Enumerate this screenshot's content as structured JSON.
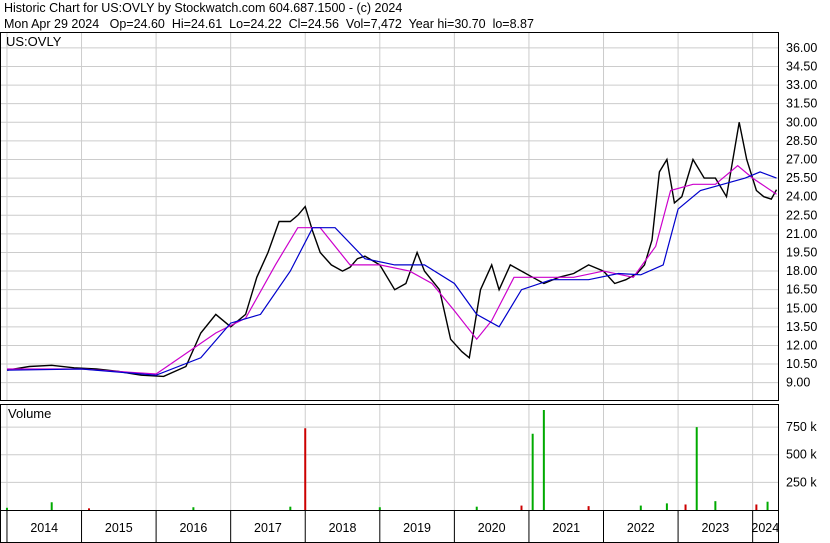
{
  "header": {
    "line1": "Historic Chart for US:OVLY by Stockwatch.com 604.687.1500 - (c) 2024",
    "line2": "Mon Apr 29 2024   Op=24.60  Hi=24.61  Lo=24.22  Cl=24.56  Vol=7,472  Year hi=30.70  lo=8.87"
  },
  "price_panel": {
    "symbol_label": "US:OVLY"
  },
  "volume_panel": {
    "label": "Volume"
  },
  "colors": {
    "price": "#000000",
    "ma_short": "#ff0000",
    "ma_mid": "#cc00cc",
    "ma_long": "#0000cc",
    "vol_up": "#00aa00",
    "vol_down": "#cc0000",
    "grid": "#cccccc"
  },
  "chart_data": {
    "type": "line",
    "price_axis": {
      "ticks": [
        "36.00",
        "34.50",
        "33.00",
        "31.50",
        "30.00",
        "28.50",
        "27.00",
        "25.50",
        "24.00",
        "22.50",
        "21.00",
        "19.50",
        "18.00",
        "16.50",
        "15.00",
        "13.50",
        "12.00",
        "10.50",
        "9.00"
      ],
      "ylim": [
        7.6,
        37.2
      ]
    },
    "volume_axis": {
      "ticks": [
        "750 k",
        "500 k",
        "250 k"
      ],
      "ylim": [
        0,
        950
      ]
    },
    "x_axis": {
      "ticks": [
        "2014",
        "2015",
        "2016",
        "2017",
        "2018",
        "2019",
        "2020",
        "2021",
        "2022",
        "2023",
        "2024"
      ],
      "xlim": [
        2013.92,
        2024.34
      ]
    },
    "series": [
      {
        "x": [
          2014.0,
          2014.3,
          2014.6,
          2014.9,
          2015.2,
          2015.5,
          2015.8,
          2016.1,
          2016.4,
          2016.6,
          2016.8,
          2017.0,
          2017.2,
          2017.35,
          2017.5,
          2017.65,
          2017.8,
          2017.9,
          2018.0,
          2018.1,
          2018.2,
          2018.35,
          2018.5,
          2018.6,
          2018.7,
          2018.8,
          2019.0,
          2019.2,
          2019.35,
          2019.5,
          2019.6,
          2019.8,
          2019.95,
          2020.1,
          2020.2,
          2020.35,
          2020.5,
          2020.6,
          2020.75,
          2020.9,
          2021.05,
          2021.2,
          2021.4,
          2021.6,
          2021.8,
          2022.0,
          2022.15,
          2022.3,
          2022.45,
          2022.55,
          2022.65,
          2022.75,
          2022.85,
          2022.95,
          2023.05,
          2023.2,
          2023.35,
          2023.5,
          2023.65,
          2023.72,
          2023.82,
          2023.92,
          2024.05,
          2024.15,
          2024.25,
          2024.32
        ],
        "values": [
          10.0,
          10.3,
          10.4,
          10.2,
          10.1,
          9.9,
          9.6,
          9.5,
          10.3,
          13.0,
          14.5,
          13.5,
          14.5,
          17.5,
          19.5,
          22.0,
          22.0,
          22.5,
          23.2,
          21.2,
          19.5,
          18.5,
          18.0,
          18.3,
          19.0,
          19.2,
          18.5,
          16.5,
          17.0,
          19.5,
          18.0,
          16.5,
          12.5,
          11.5,
          11.0,
          16.5,
          18.5,
          16.5,
          18.5,
          18.0,
          17.5,
          17.0,
          17.5,
          17.8,
          18.5,
          18.0,
          17.0,
          17.3,
          17.8,
          18.5,
          20.5,
          26.0,
          27.0,
          23.5,
          24.0,
          27.0,
          25.5,
          25.5,
          24.0,
          26.5,
          30.0,
          27.0,
          24.5,
          24.0,
          23.8,
          24.56
        ]
      },
      {
        "name": "",
        "x": [
          2014.0,
          2015.0,
          2016.0,
          2016.8,
          2017.2,
          2017.6,
          2017.9,
          2018.2,
          2018.6,
          2019.0,
          2019.4,
          2019.7,
          2020.0,
          2020.3,
          2020.5,
          2020.8,
          2021.2,
          2021.6,
          2022.0,
          2022.4,
          2022.7,
          2022.9,
          2023.2,
          2023.5,
          2023.8,
          2024.0,
          2024.32
        ],
        "values": [
          10.1,
          10.1,
          9.7,
          13.0,
          14.2,
          18.5,
          21.5,
          21.5,
          18.5,
          18.5,
          18.0,
          17.0,
          14.8,
          12.5,
          14.0,
          17.5,
          17.5,
          17.5,
          18.0,
          17.5,
          20.0,
          24.5,
          25.0,
          25.0,
          26.5,
          25.5,
          24.2
        ]
      },
      {
        "name": "",
        "x": [
          2014.0,
          2015.0,
          2016.0,
          2016.6,
          2017.0,
          2017.4,
          2017.8,
          2018.1,
          2018.4,
          2018.8,
          2019.2,
          2019.6,
          2020.0,
          2020.3,
          2020.6,
          2020.9,
          2021.3,
          2021.8,
          2022.2,
          2022.5,
          2022.8,
          2023.0,
          2023.3,
          2023.6,
          2023.9,
          2024.1,
          2024.32
        ],
        "values": [
          10.0,
          10.1,
          9.6,
          11.0,
          13.8,
          14.5,
          18.0,
          21.5,
          21.5,
          19.0,
          18.5,
          18.5,
          17.0,
          14.5,
          13.5,
          16.5,
          17.3,
          17.3,
          17.8,
          17.7,
          18.5,
          23.0,
          24.5,
          25.0,
          25.5,
          26.0,
          25.5
        ]
      },
      {
        "name": "Volume",
        "x": [
          2014.0,
          2014.6,
          2015.1,
          2016.5,
          2017.8,
          2018.0,
          2019.0,
          2020.3,
          2020.9,
          2021.05,
          2021.2,
          2021.8,
          2022.5,
          2022.85,
          2023.1,
          2023.25,
          2023.5,
          2024.05,
          2024.2
        ],
        "values": [
          20,
          70,
          15,
          25,
          30,
          740,
          25,
          30,
          40,
          690,
          905,
          35,
          40,
          60,
          50,
          750,
          80,
          50,
          75
        ]
      }
    ]
  }
}
